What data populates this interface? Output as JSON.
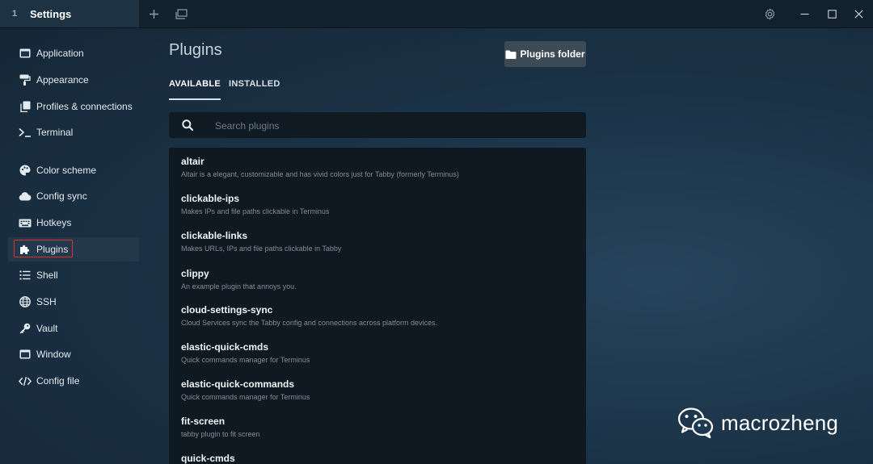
{
  "titlebar": {
    "tab_number": "1",
    "tab_title": "Settings"
  },
  "sidebar": {
    "items": [
      {
        "label": "Application",
        "icon": "window-icon"
      },
      {
        "label": "Appearance",
        "icon": "paint-roller-icon"
      },
      {
        "label": "Profiles & connections",
        "icon": "copy-icon"
      },
      {
        "label": "Terminal",
        "icon": "terminal-icon"
      },
      {
        "label": "Color scheme",
        "icon": "palette-icon"
      },
      {
        "label": "Config sync",
        "icon": "cloud-icon"
      },
      {
        "label": "Hotkeys",
        "icon": "keyboard-icon"
      },
      {
        "label": "Plugins",
        "icon": "puzzle-icon",
        "active": true
      },
      {
        "label": "Shell",
        "icon": "list-icon"
      },
      {
        "label": "SSH",
        "icon": "globe-icon"
      },
      {
        "label": "Vault",
        "icon": "key-icon"
      },
      {
        "label": "Window",
        "icon": "window-icon"
      },
      {
        "label": "Config file",
        "icon": "code-icon"
      }
    ]
  },
  "main": {
    "title": "Plugins",
    "folder_button": "Plugins folder",
    "tabs": [
      {
        "label": "AVAILABLE",
        "active": true
      },
      {
        "label": "INSTALLED",
        "active": false
      }
    ],
    "search_placeholder": "Search plugins",
    "plugins": [
      {
        "name": "altair",
        "description": "Altair is a elegant, customizable and has vivid colors just for Tabby (formerly Terminus)"
      },
      {
        "name": "clickable-ips",
        "description": "Makes IPs and file paths clickable in Terminus"
      },
      {
        "name": "clickable-links",
        "description": "Makes URLs, IPs and file paths clickable in Tabby"
      },
      {
        "name": "clippy",
        "description": "An example plugin that annoys you."
      },
      {
        "name": "cloud-settings-sync",
        "description": "Cloud Services sync the Tabby config and connections across platform devices."
      },
      {
        "name": "elastic-quick-cmds",
        "description": "Quick commands manager for Terminus"
      },
      {
        "name": "elastic-quick-commands",
        "description": "Quick commands manager for Terminus"
      },
      {
        "name": "fit-screen",
        "description": "tabby plugin to fit screen"
      },
      {
        "name": "quick-cmds",
        "description": ""
      }
    ]
  },
  "watermark": {
    "text": "macrozheng"
  },
  "colors": {
    "background": "#1b3347",
    "titlebar": "#13212d",
    "panel": "#0f1922",
    "highlight_box": "#d9302c"
  }
}
